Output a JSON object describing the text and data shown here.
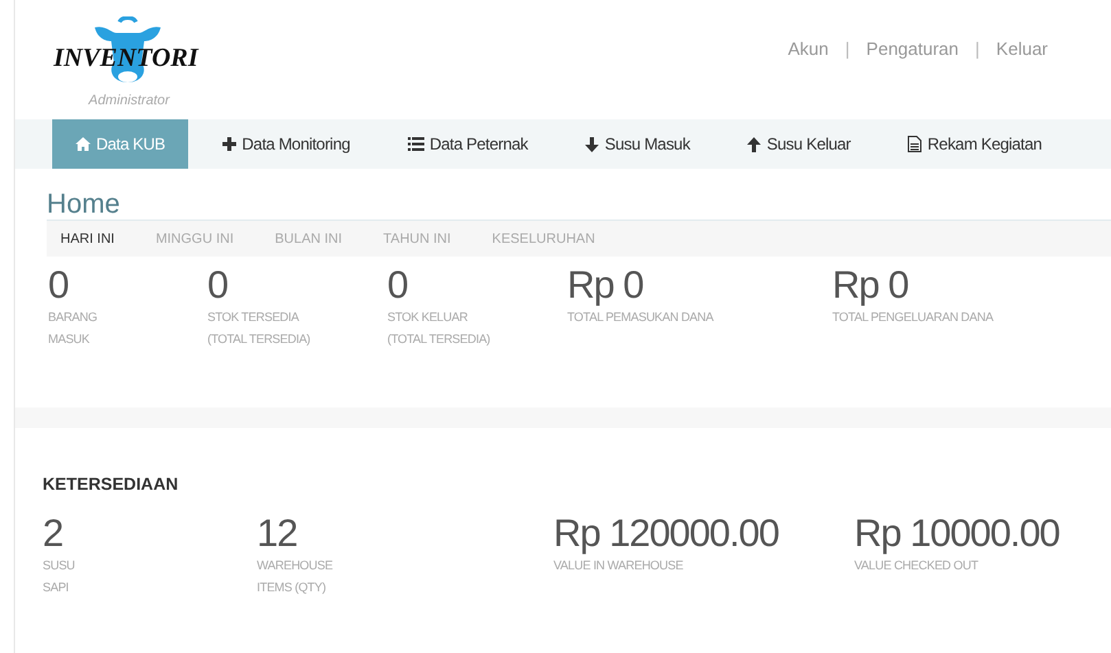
{
  "header": {
    "logo_text": "INVENTORI",
    "role": "Administrator",
    "links": [
      "Akun",
      "Pengaturan",
      "Keluar"
    ],
    "separator": "|"
  },
  "nav": [
    {
      "label": "Data KUB",
      "kind": "home",
      "selected": true
    },
    {
      "label": "Data Monitoring",
      "kind": "plus",
      "selected": false
    },
    {
      "label": "Data Peternak",
      "kind": "list",
      "selected": false
    },
    {
      "label": "Susu Masuk",
      "kind": "down",
      "selected": false
    },
    {
      "label": "Susu Keluar",
      "kind": "up",
      "selected": false
    },
    {
      "label": "Rekam Kegiatan",
      "kind": "doc",
      "selected": false
    }
  ],
  "page_title": "Home",
  "periods": [
    {
      "label": "HARI INI",
      "selected": true
    },
    {
      "label": "MINGGU INI",
      "selected": false
    },
    {
      "label": "BULAN INI",
      "selected": false
    },
    {
      "label": "TAHUN INI",
      "selected": false
    },
    {
      "label": "KESELURUHAN",
      "selected": false
    }
  ],
  "summary": [
    {
      "value": "0",
      "label": [
        "BARANG",
        "MASUK"
      ]
    },
    {
      "value": "0",
      "label": [
        "STOK TERSEDIA",
        "(TOTAL TERSEDIA)"
      ]
    },
    {
      "value": "0",
      "label": [
        "STOK KELUAR",
        "(TOTAL TERSEDIA)"
      ]
    },
    {
      "value": "Rp 0",
      "label": [
        "TOTAL PEMASUKAN DANA"
      ]
    },
    {
      "value": "Rp 0",
      "label": [
        "TOTAL PENGELUARAN DANA"
      ]
    }
  ],
  "availability": {
    "title": "KETERSEDIAAN",
    "stats": [
      {
        "value": "2",
        "label": [
          "SUSU",
          "SAPI"
        ]
      },
      {
        "value": "12",
        "label": [
          "WAREHOUSE",
          "ITEMS (QTY)"
        ]
      },
      {
        "value": "Rp 120000.00",
        "label": [
          "VALUE IN WAREHOUSE"
        ]
      },
      {
        "value": "Rp 10000.00",
        "label": [
          "VALUE CHECKED OUT"
        ]
      }
    ]
  }
}
